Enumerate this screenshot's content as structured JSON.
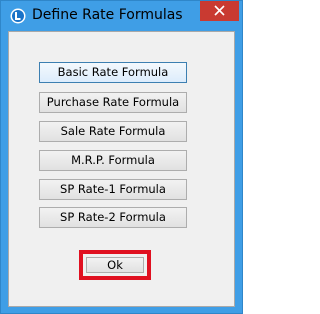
{
  "window": {
    "title": "Define Rate Formulas",
    "icon": "app-icon",
    "close_icon": "close-icon"
  },
  "buttons": [
    {
      "label": "Basic Rate Formula",
      "focused": true
    },
    {
      "label": "Purchase Rate Formula",
      "focused": false
    },
    {
      "label": "Sale Rate Formula",
      "focused": false
    },
    {
      "label": "M.R.P. Formula",
      "focused": false
    },
    {
      "label": "SP Rate-1 Formula",
      "focused": false
    },
    {
      "label": "SP Rate-2 Formula",
      "focused": false
    }
  ],
  "ok_button": {
    "label": "Ok",
    "highlight_color": "#e01020"
  },
  "colors": {
    "titlebar": "#3f9ee6",
    "close_button": "#c93a31",
    "dialog_background": "#f0f0f0"
  }
}
